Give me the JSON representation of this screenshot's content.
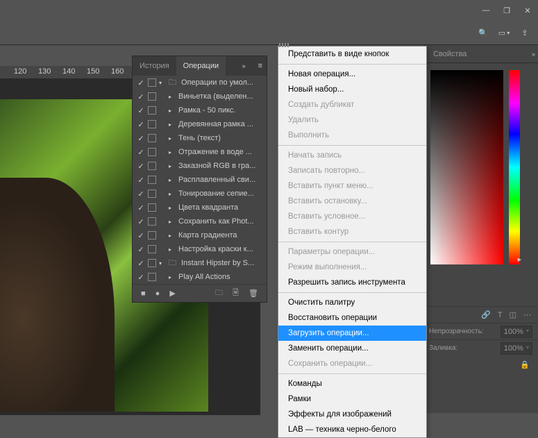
{
  "window": {
    "minimize": "—",
    "maximize": "❐",
    "close": "✕"
  },
  "toolbar": {
    "search": "🔍",
    "screen": "▭",
    "arrow": "▾",
    "share": "⇪",
    "more": "»"
  },
  "ruler": {
    "ticks": [
      "120",
      "130",
      "140",
      "150",
      "160"
    ]
  },
  "right_panel": {
    "properties_tab": "Свойства",
    "more": "»",
    "opacity_label": "Непрозрачность:",
    "opacity_value": "100%",
    "fill_label": "Заливка:",
    "fill_value": "100%",
    "lock": "🔒",
    "icons": {
      "link": "🔗",
      "type": "T",
      "crop": "◫",
      "dots": "⋯"
    }
  },
  "actions_panel": {
    "tab_history": "История",
    "tab_actions": "Операции",
    "more": "»",
    "items": [
      {
        "check": "✓",
        "folder": true,
        "expand": "▾",
        "label": "Операции по умол..."
      },
      {
        "check": "✓",
        "tri": "▸",
        "label": "Виньетка (выделен..."
      },
      {
        "check": "✓",
        "tri": "▸",
        "label": "Рамка - 50 пикс."
      },
      {
        "check": "✓",
        "tri": "▸",
        "label": "Деревянная рамка ..."
      },
      {
        "check": "✓",
        "tri": "▸",
        "label": "Тень (текст)"
      },
      {
        "check": "✓",
        "tri": "▸",
        "label": "Отражение в воде ..."
      },
      {
        "check": "✓",
        "tri": "▸",
        "label": "Заказной RGB в гра..."
      },
      {
        "check": "✓",
        "tri": "▸",
        "label": "Расплавленный сви..."
      },
      {
        "check": "✓",
        "tri": "▸",
        "label": "Тонирование сепие..."
      },
      {
        "check": "✓",
        "tri": "▸",
        "label": "Цвета квадранта"
      },
      {
        "check": "✓",
        "tri": "▸",
        "label": "Сохранить как Phot..."
      },
      {
        "check": "✓",
        "tri": "▸",
        "label": "Карта градиента"
      },
      {
        "check": "✓",
        "tri": "▸",
        "label": "Настройка краски к..."
      },
      {
        "check": "✓",
        "folder": true,
        "expand": "▾",
        "label": "Instant Hipster by S..."
      },
      {
        "check": "✓",
        "tri": "▸",
        "label": "Play All Actions"
      }
    ],
    "footer": {
      "stop": "■",
      "rec": "●",
      "play": "▶",
      "newset": "🗀",
      "new": "🗎",
      "trash": "🗑"
    }
  },
  "flyout": {
    "groups": [
      [
        {
          "t": "Представить в виде кнопок",
          "d": false
        }
      ],
      [
        {
          "t": "Новая операция...",
          "d": false
        },
        {
          "t": "Новый набор...",
          "d": false
        },
        {
          "t": "Создать дубликат",
          "d": true
        },
        {
          "t": "Удалить",
          "d": true
        },
        {
          "t": "Выполнить",
          "d": true
        }
      ],
      [
        {
          "t": "Начать запись",
          "d": true
        },
        {
          "t": "Записать повторно...",
          "d": true
        },
        {
          "t": "Вставить пункт меню...",
          "d": true
        },
        {
          "t": "Вставить остановку...",
          "d": true
        },
        {
          "t": "Вставить условное...",
          "d": true
        },
        {
          "t": "Вставить контур",
          "d": true
        }
      ],
      [
        {
          "t": "Параметры операции...",
          "d": true
        },
        {
          "t": "Режим выполнения...",
          "d": true
        },
        {
          "t": "Разрешить запись инструмента",
          "d": false
        }
      ],
      [
        {
          "t": "Очистить палитру",
          "d": false
        },
        {
          "t": "Восстановить операции",
          "d": false
        },
        {
          "t": "Загрузить операции...",
          "d": false,
          "sel": true
        },
        {
          "t": "Заменить операции...",
          "d": false
        },
        {
          "t": "Сохранить операции...",
          "d": true
        }
      ],
      [
        {
          "t": "Команды",
          "d": false
        },
        {
          "t": "Рамки",
          "d": false
        },
        {
          "t": "Эффекты для изображений",
          "d": false
        },
        {
          "t": "LAB — техника черно-белого",
          "d": false
        }
      ]
    ]
  }
}
